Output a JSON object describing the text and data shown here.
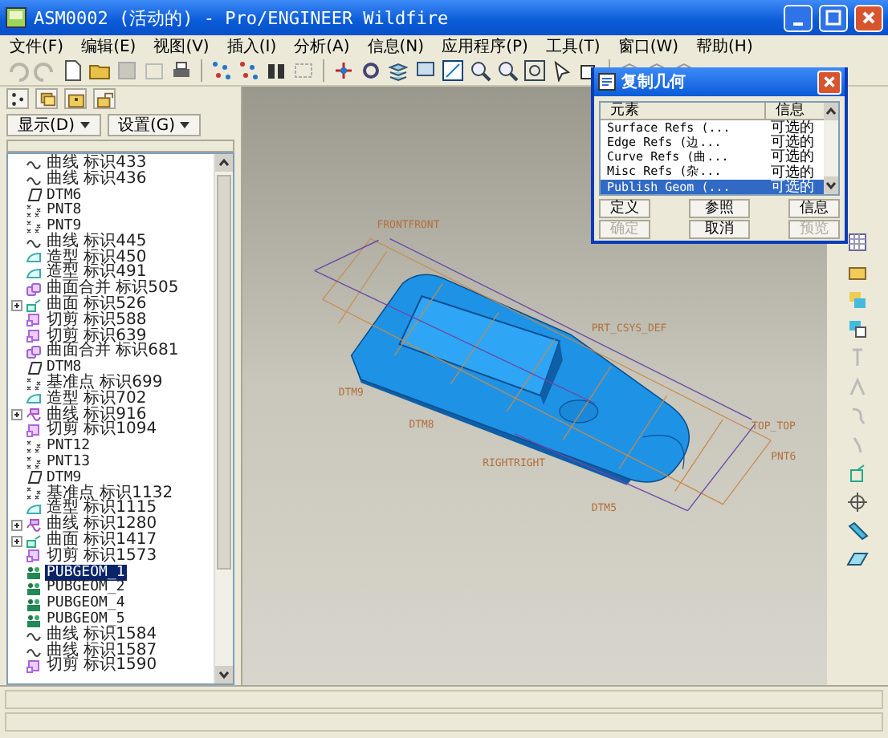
{
  "window": {
    "title": "ASM0002 (活动的) - Pro/ENGINEER Wildfire"
  },
  "menu": [
    "文件(F)",
    "编辑(E)",
    "视图(V)",
    "插入(I)",
    "分析(A)",
    "信息(N)",
    "应用程序(P)",
    "工具(T)",
    "窗口(W)",
    "帮助(H)"
  ],
  "navigator": {
    "buttons": [
      "显示(D)",
      "设置(G)"
    ],
    "tree": [
      {
        "kind": "curve",
        "label": "曲线 标识433",
        "expandable": false,
        "selected": false
      },
      {
        "kind": "curve",
        "label": "曲线 标识436",
        "expandable": false,
        "selected": false
      },
      {
        "kind": "plane",
        "label": "DTM6",
        "expandable": false,
        "selected": false
      },
      {
        "kind": "point",
        "label": "PNT8",
        "expandable": false,
        "selected": false
      },
      {
        "kind": "point",
        "label": "PNT9",
        "expandable": false,
        "selected": false
      },
      {
        "kind": "curve",
        "label": "曲线 标识445",
        "expandable": false,
        "selected": false
      },
      {
        "kind": "style",
        "label": "造型 标识450",
        "expandable": false,
        "selected": false
      },
      {
        "kind": "style",
        "label": "造型 标识491",
        "expandable": false,
        "selected": false
      },
      {
        "kind": "merge",
        "label": "曲面合并 标识505",
        "expandable": false,
        "selected": false
      },
      {
        "kind": "surface",
        "label": "曲面 标识526",
        "expandable": true,
        "selected": false
      },
      {
        "kind": "cut",
        "label": "切剪 标识588",
        "expandable": false,
        "selected": false
      },
      {
        "kind": "cut",
        "label": "切剪 标识639",
        "expandable": false,
        "selected": false
      },
      {
        "kind": "merge",
        "label": "曲面合并 标识681",
        "expandable": false,
        "selected": false
      },
      {
        "kind": "plane",
        "label": "DTM8",
        "expandable": false,
        "selected": false
      },
      {
        "kind": "point",
        "label": "基准点 标识699",
        "expandable": false,
        "selected": false
      },
      {
        "kind": "style",
        "label": "造型 标识702",
        "expandable": false,
        "selected": false
      },
      {
        "kind": "curvegroup",
        "label": "曲线 标识916",
        "expandable": true,
        "selected": false
      },
      {
        "kind": "cut",
        "label": "切剪 标识1094",
        "expandable": false,
        "selected": false
      },
      {
        "kind": "point",
        "label": "PNT12",
        "expandable": false,
        "selected": false
      },
      {
        "kind": "point",
        "label": "PNT13",
        "expandable": false,
        "selected": false
      },
      {
        "kind": "plane",
        "label": "DTM9",
        "expandable": false,
        "selected": false
      },
      {
        "kind": "point",
        "label": "基准点 标识1132",
        "expandable": false,
        "selected": false
      },
      {
        "kind": "style",
        "label": "造型 标识1115",
        "expandable": false,
        "selected": false
      },
      {
        "kind": "curvegroup",
        "label": "曲线 标识1280",
        "expandable": true,
        "selected": false
      },
      {
        "kind": "surface",
        "label": "曲面 标识1417",
        "expandable": true,
        "selected": false
      },
      {
        "kind": "cut",
        "label": "切剪 标识1573",
        "expandable": false,
        "selected": false
      },
      {
        "kind": "pubgeom",
        "label": "PUBGEOM_1",
        "expandable": false,
        "selected": true
      },
      {
        "kind": "pubgeom",
        "label": "PUBGEOM_2",
        "expandable": false,
        "selected": false
      },
      {
        "kind": "pubgeom",
        "label": "PUBGEOM_4",
        "expandable": false,
        "selected": false
      },
      {
        "kind": "pubgeom",
        "label": "PUBGEOM_5",
        "expandable": false,
        "selected": false
      },
      {
        "kind": "curve",
        "label": "曲线 标识1584",
        "expandable": false,
        "selected": false
      },
      {
        "kind": "curve",
        "label": "曲线 标识1587",
        "expandable": false,
        "selected": false
      },
      {
        "kind": "cut",
        "label": "切剪 标识1590",
        "expandable": false,
        "selected": false
      }
    ]
  },
  "model": {
    "labels": [
      "FRONTFRONT",
      "PRT_CSYS_DEF",
      "RIGHTRIGHT",
      "TOP_TOP",
      "PNT6",
      "DTM9",
      "DTM8",
      "DTM5"
    ]
  },
  "dialog": {
    "title": "复制几何",
    "columns": [
      "元素",
      "信息"
    ],
    "rows": [
      {
        "element": "Surface Refs (...",
        "info": "可选的",
        "selected": false
      },
      {
        "element": "Edge Refs (边...",
        "info": "可选的",
        "selected": false
      },
      {
        "element": "Curve Refs (曲...",
        "info": "可选的",
        "selected": false
      },
      {
        "element": "Misc Refs (杂...",
        "info": "可选的",
        "selected": false
      },
      {
        "element": "Publish Geom (...",
        "info": "可选的",
        "selected": true
      }
    ],
    "buttons": [
      {
        "label": "定义",
        "disabled": false
      },
      {
        "label": "参照",
        "disabled": false
      },
      {
        "label": "信息",
        "disabled": false
      },
      {
        "label": "确定",
        "disabled": true
      },
      {
        "label": "取消",
        "disabled": false
      },
      {
        "label": "预览",
        "disabled": true
      }
    ]
  }
}
